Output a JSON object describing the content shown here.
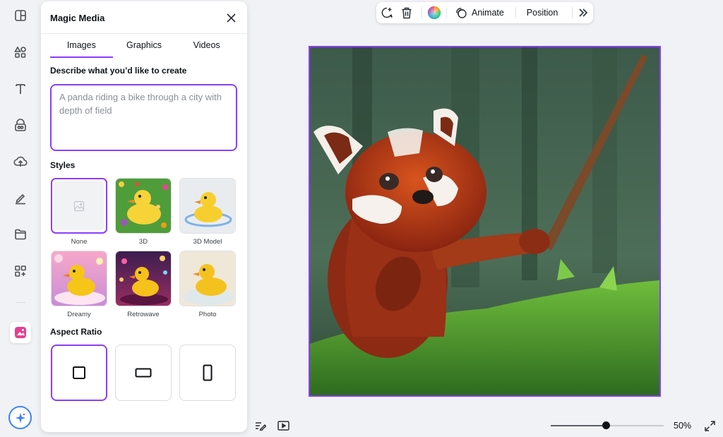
{
  "panel": {
    "title": "Magic Media",
    "tabs": [
      {
        "label": "Images",
        "active": true
      },
      {
        "label": "Graphics",
        "active": false
      },
      {
        "label": "Videos",
        "active": false
      }
    ],
    "prompt_label": "Describe what you’d like to create",
    "prompt_placeholder": "A panda riding a bike through a city with depth of field",
    "styles_label": "Styles",
    "styles": [
      {
        "label": "None",
        "selected": true
      },
      {
        "label": "3D",
        "selected": false
      },
      {
        "label": "3D Model",
        "selected": false
      },
      {
        "label": "Dreamy",
        "selected": false
      },
      {
        "label": "Retrowave",
        "selected": false
      },
      {
        "label": "Photo",
        "selected": false
      }
    ],
    "aspect_label": "Aspect Ratio",
    "aspect_options": [
      {
        "name": "square",
        "selected": true
      },
      {
        "name": "landscape",
        "selected": false
      },
      {
        "name": "portrait",
        "selected": false
      }
    ]
  },
  "rail": {
    "icons": [
      "design-icon",
      "elements-icon",
      "text-icon",
      "brand-icon",
      "uploads-icon",
      "draw-icon",
      "projects-icon",
      "apps-icon",
      "magic-media-icon"
    ],
    "bottom_icon": "magic-sparkle-icon"
  },
  "toolbar": {
    "animate_label": "Animate",
    "position_label": "Position",
    "icons": [
      "add-comment-icon",
      "trash-icon",
      "color-wheel-icon",
      "animate-icon",
      "more-icon"
    ]
  },
  "canvas": {
    "image_subject": "red panda holding a stick in grass",
    "selected": true
  },
  "footer": {
    "zoom_label": "50%",
    "zoom_fraction": 0.49,
    "icons": [
      "notes-icon",
      "present-icon",
      "fullscreen-icon"
    ]
  },
  "colors": {
    "accent": "#8b3dff",
    "magic_border": "#3b82f6"
  }
}
